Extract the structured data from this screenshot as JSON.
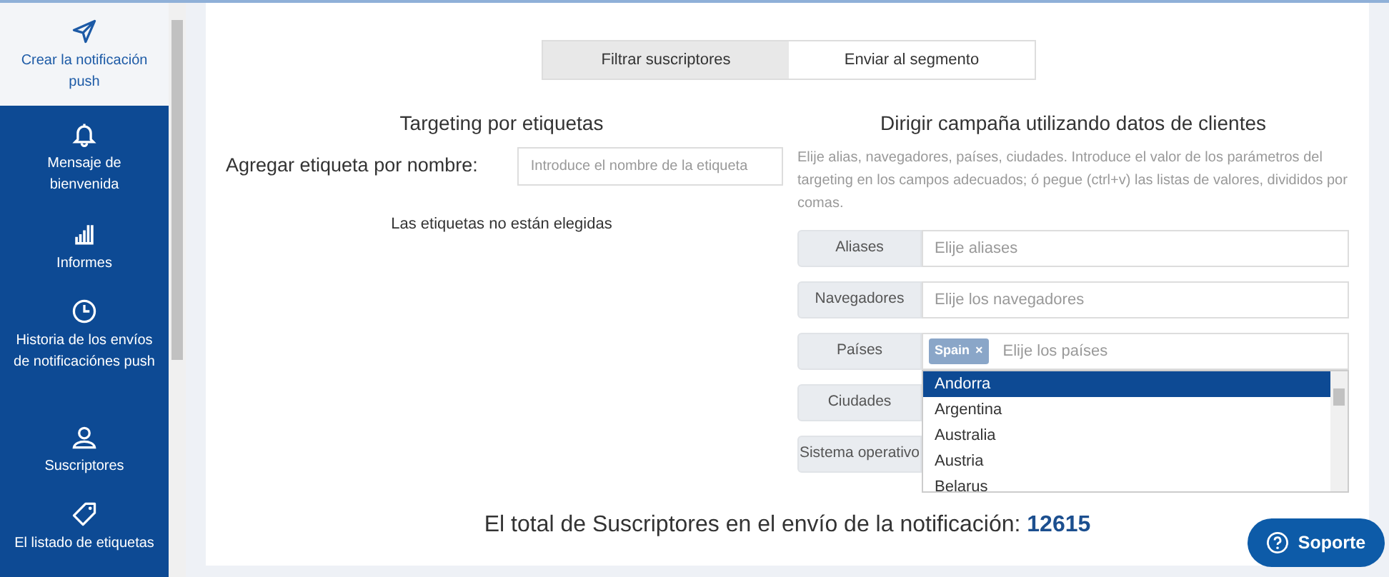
{
  "sidebar": {
    "items": [
      {
        "label": "Crear la notificación push",
        "selected": true
      },
      {
        "label": "Mensaje de bienvenida",
        "selected": false
      },
      {
        "label": "Informes",
        "selected": false
      },
      {
        "label": "Historia de los envíos de notificaciónes push",
        "selected": false
      },
      {
        "label": "Suscriptores",
        "selected": false
      },
      {
        "label": "El listado de etiquetas",
        "selected": false
      }
    ]
  },
  "tabs": [
    {
      "label": "Filtrar suscriptores",
      "selected": true
    },
    {
      "label": "Enviar al segmento",
      "selected": false
    }
  ],
  "tag_targeting": {
    "title": "Targeting por etiquetas",
    "field_label": "Agregar etiqueta por nombre:",
    "placeholder": "Introduce el nombre de la etiqueta",
    "empty_note": "Las etiquetas no están elegidas"
  },
  "client_targeting": {
    "title": "Dirigir campaña utilizando datos de clientes",
    "description": "Elije alias, navegadores, países, ciudades. Introduce el valor de los parámetros del targeting en los campos adecuados; ó pegue (ctrl+v) las listas de valores, divididos por comas.",
    "fields": [
      {
        "label": "Aliases",
        "placeholder": "Elije aliases"
      },
      {
        "label": "Navegadores",
        "placeholder": "Elije los navegadores"
      },
      {
        "label": "Países",
        "placeholder": "Elije los países",
        "tags": [
          {
            "label": "Spain",
            "remove": "×"
          }
        ]
      },
      {
        "label": "Ciudades"
      },
      {
        "label": "Sistema operativo"
      }
    ],
    "dropdown_options": [
      {
        "label": "Andorra",
        "selected": true
      },
      {
        "label": "Argentina",
        "selected": false
      },
      {
        "label": "Australia",
        "selected": false
      },
      {
        "label": "Austria",
        "selected": false
      },
      {
        "label": "Belarus",
        "selected": false
      }
    ]
  },
  "total": {
    "label": "El total de Suscriptores en el envío de la notificación:",
    "value": "12615"
  },
  "support_button": {
    "label": "Soporte"
  }
}
